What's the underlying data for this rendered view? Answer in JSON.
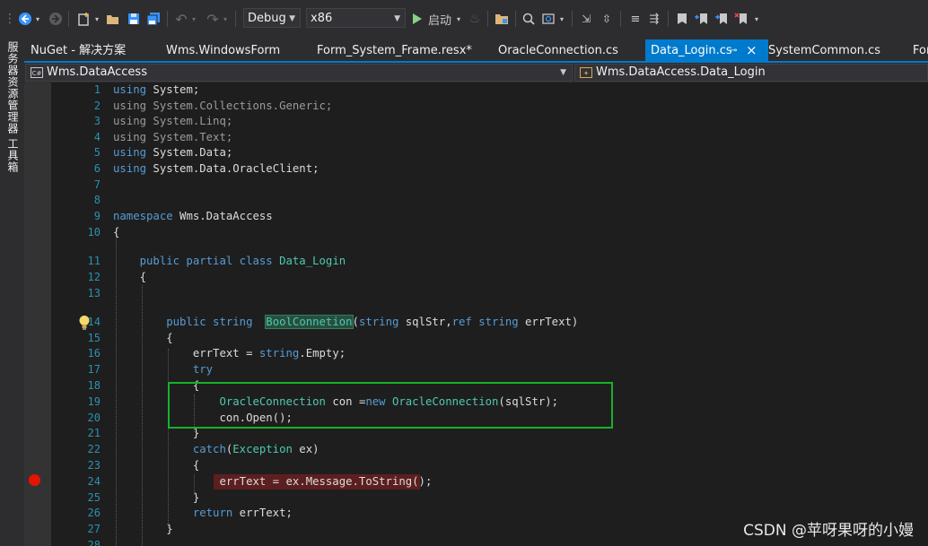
{
  "toolbar": {
    "config": "Debug",
    "platform": "x86",
    "start_label": "启动"
  },
  "sidebar": {
    "items": [
      "服务器资源管理器",
      "工具箱"
    ]
  },
  "tabs": [
    {
      "label": "NuGet - 解决方案"
    },
    {
      "label": "Wms.WindowsForm"
    },
    {
      "label": "Form_System_Frame.resx*"
    },
    {
      "label": "OracleConnection.cs"
    },
    {
      "label": "Data_Login.cs"
    },
    {
      "label": "SystemCommon.cs"
    },
    {
      "label": "For"
    }
  ],
  "navbar": {
    "project": "Wms.DataAccess",
    "type": "Wms.DataAccess.Data_Login"
  },
  "colors": {
    "keyword": "#569cd6",
    "type": "#4ec9b0",
    "line_number": "#2b91af",
    "highlight_box": "#17b12d",
    "breakpoint": "#e51400"
  },
  "code_lines": [
    {
      "n": "1",
      "segs": [
        [
          "using",
          "kw"
        ],
        [
          " System;",
          "tx"
        ]
      ]
    },
    {
      "n": "2",
      "segs": [
        [
          "using System.Collections.Generic;",
          "dim"
        ]
      ]
    },
    {
      "n": "3",
      "segs": [
        [
          "using System.Linq;",
          "dim"
        ]
      ]
    },
    {
      "n": "4",
      "segs": [
        [
          "using System.Text;",
          "dim"
        ]
      ]
    },
    {
      "n": "5",
      "segs": [
        [
          "using",
          "kw"
        ],
        [
          " System.Data;",
          "tx"
        ]
      ]
    },
    {
      "n": "6",
      "segs": [
        [
          "using",
          "kw"
        ],
        [
          " System.Data.OracleClient;",
          "tx"
        ]
      ]
    },
    {
      "n": "7",
      "segs": []
    },
    {
      "n": "8",
      "segs": []
    },
    {
      "n": "9",
      "segs": [
        [
          "namespace",
          "kw"
        ],
        [
          " Wms.DataAccess",
          "tx"
        ]
      ]
    },
    {
      "n": "10",
      "segs": [
        [
          "{",
          "tx"
        ]
      ]
    },
    {
      "n": "11",
      "segs": [
        [
          "    public partial class",
          "kw"
        ],
        [
          " Data_Login",
          "ty"
        ]
      ]
    },
    {
      "n": "12",
      "segs": [
        [
          "    {",
          "tx"
        ]
      ]
    },
    {
      "n": "13",
      "segs": []
    },
    {
      "n": "14",
      "segs": [
        [
          "        public string",
          "kw"
        ],
        [
          "  ",
          "tx"
        ],
        [
          "BoolConnetion",
          "sel"
        ],
        [
          "(",
          "tx"
        ],
        [
          "string",
          "kw"
        ],
        [
          " sqlStr,",
          "tx"
        ],
        [
          "ref string",
          "kw"
        ],
        [
          " errText)",
          "tx"
        ]
      ]
    },
    {
      "n": "15",
      "segs": [
        [
          "        {",
          "tx"
        ]
      ]
    },
    {
      "n": "16",
      "segs": [
        [
          "            errText = ",
          "tx"
        ],
        [
          "string",
          "kw"
        ],
        [
          ".Empty;",
          "tx"
        ]
      ]
    },
    {
      "n": "17",
      "segs": [
        [
          "            try",
          "kw"
        ]
      ]
    },
    {
      "n": "18",
      "segs": [
        [
          "            {",
          "tx"
        ]
      ]
    },
    {
      "n": "19",
      "segs": [
        [
          "                OracleConnection",
          "ty"
        ],
        [
          " con =",
          "tx"
        ],
        [
          "new",
          "kw"
        ],
        [
          " OracleConnection",
          "ty"
        ],
        [
          "(sqlStr);",
          "tx"
        ]
      ]
    },
    {
      "n": "20",
      "segs": [
        [
          "                con.Open();",
          "tx"
        ]
      ]
    },
    {
      "n": "21",
      "segs": [
        [
          "            }",
          "tx"
        ]
      ]
    },
    {
      "n": "22",
      "segs": [
        [
          "            catch",
          "kw"
        ],
        [
          "(",
          "tx"
        ],
        [
          "Exception",
          "ty"
        ],
        [
          " ex)",
          "tx"
        ]
      ]
    },
    {
      "n": "23",
      "segs": [
        [
          "            {",
          "tx"
        ]
      ]
    },
    {
      "n": "24",
      "segs": [
        [
          "                errText = ex.Message.ToString();",
          "tx"
        ]
      ]
    },
    {
      "n": "25",
      "segs": [
        [
          "            }",
          "tx"
        ]
      ]
    },
    {
      "n": "26",
      "segs": [
        [
          "            return",
          "kw"
        ],
        [
          " errText;",
          "tx"
        ]
      ]
    },
    {
      "n": "27",
      "segs": [
        [
          "        }",
          "tx"
        ]
      ]
    },
    {
      "n": "28",
      "segs": []
    }
  ],
  "watermark": "CSDN @苹呀果呀的小嫚"
}
